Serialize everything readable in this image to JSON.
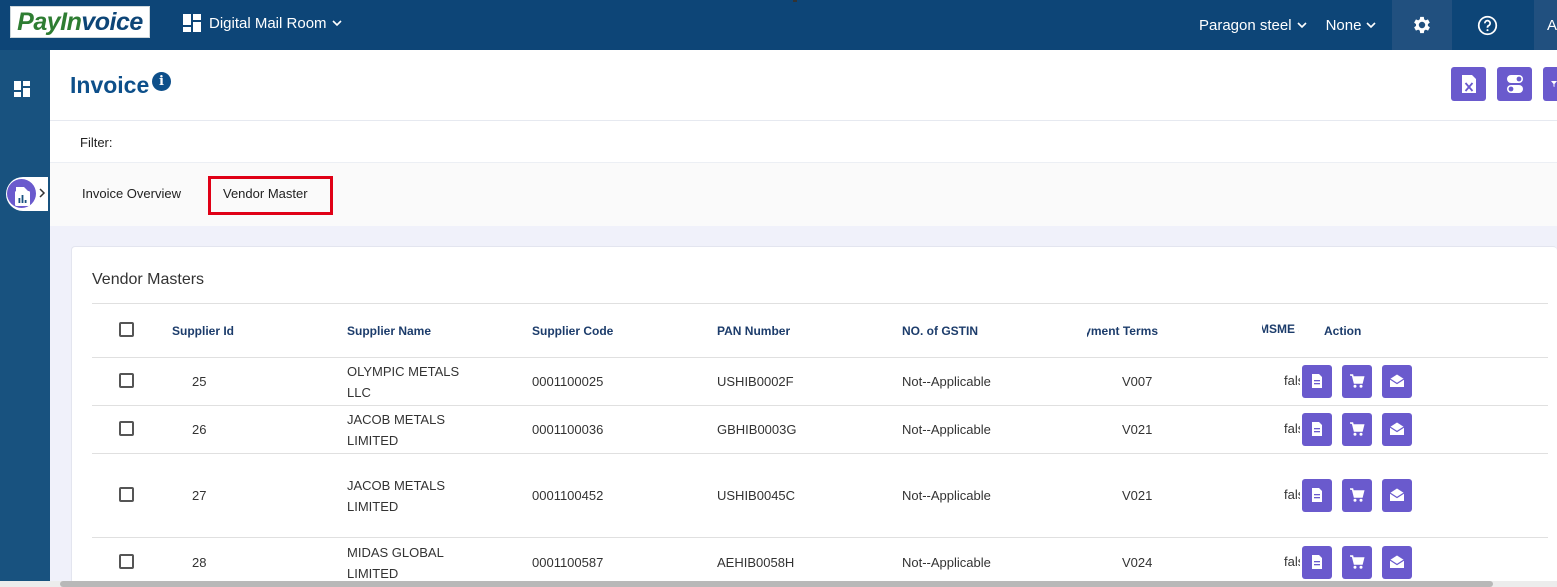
{
  "brand": {
    "logo_part1": "PayIn",
    "logo_part2": "voice",
    "accent": "#0d4577",
    "button_color": "#6a5acd"
  },
  "topbar": {
    "app_name": "Digital Mail Room",
    "company": "Paragon steel",
    "scope": "None",
    "user_initial": "A",
    "icons": [
      "grid-icon",
      "chevron-down-icon",
      "gear-icon",
      "help-icon"
    ]
  },
  "sidebar": {
    "items": [
      "dashboard-icon",
      "document-icon",
      "report-icon"
    ]
  },
  "header": {
    "title": "Invoice",
    "info_glyph": "i",
    "buttons": [
      "excel-export-icon",
      "toggle-icon",
      "filter-icon"
    ]
  },
  "filter": {
    "label": "Filter:"
  },
  "tabs": [
    {
      "label": "Invoice Overview",
      "active": false
    },
    {
      "label": "Vendor Master",
      "active": true
    }
  ],
  "vendor_masters": {
    "title": "Vendor Masters",
    "columns": [
      "Supplier Id",
      "Supplier Name",
      "Supplier Code",
      "PAN Number",
      "NO. of GSTIN",
      "Payment Terms",
      "MSME S",
      "Action"
    ],
    "rows": [
      {
        "id": "25",
        "name": "OLYMPIC METALS LLC",
        "code": "0001100025",
        "pan": "USHIB0002F",
        "gstin": "Not--Applicable",
        "terms": "V007",
        "msme": "false"
      },
      {
        "id": "26",
        "name": "JACOB METALS LIMITED",
        "code": "0001100036",
        "pan": "GBHIB0003G",
        "gstin": "Not--Applicable",
        "terms": "V021",
        "msme": "false"
      },
      {
        "id": "27",
        "name": "JACOB METALS LIMITED",
        "code": "0001100452",
        "pan": "USHIB0045C",
        "gstin": "Not--Applicable",
        "terms": "V021",
        "msme": "false"
      },
      {
        "id": "28",
        "name": "MIDAS GLOBAL LIMITED",
        "code": "0001100587",
        "pan": "AEHIB0058H",
        "gstin": "Not--Applicable",
        "terms": "V024",
        "msme": "false"
      }
    ],
    "row_actions": [
      "document-icon",
      "cart-icon",
      "mail-open-icon"
    ]
  }
}
